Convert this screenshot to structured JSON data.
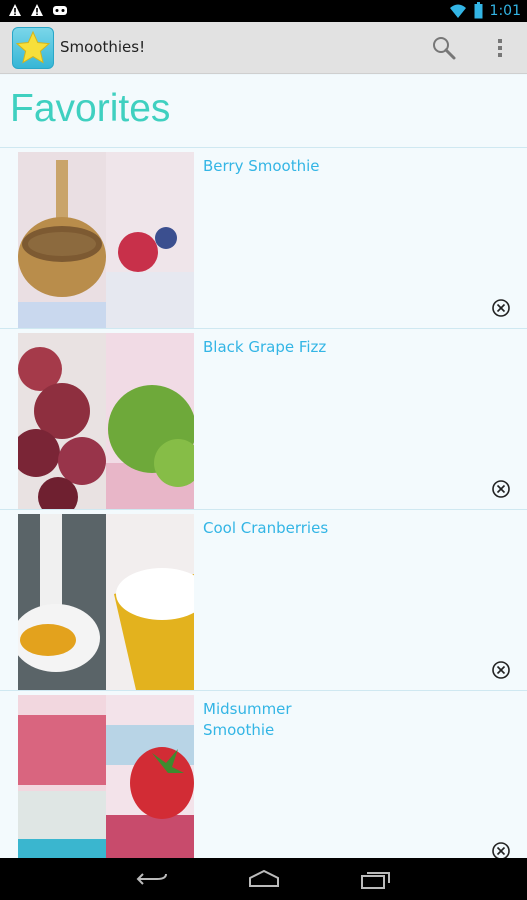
{
  "status_bar": {
    "time": "1:01"
  },
  "app": {
    "title": "Smoothies!"
  },
  "page": {
    "title": "Favorites"
  },
  "items": [
    {
      "name": "Berry Smoothie"
    },
    {
      "name": "Black Grape Fizz"
    },
    {
      "name": "Cool Cranberries"
    },
    {
      "name": "Midsummer Smoothie"
    }
  ],
  "colors": {
    "accent": "#33b5e5",
    "heading": "#3fd0c0",
    "background": "#f3fafd"
  },
  "icons": {
    "search": "search-icon",
    "overflow": "overflow-menu-icon",
    "remove": "remove-circle-icon",
    "back": "back-icon",
    "home": "home-icon",
    "recents": "recents-icon"
  }
}
